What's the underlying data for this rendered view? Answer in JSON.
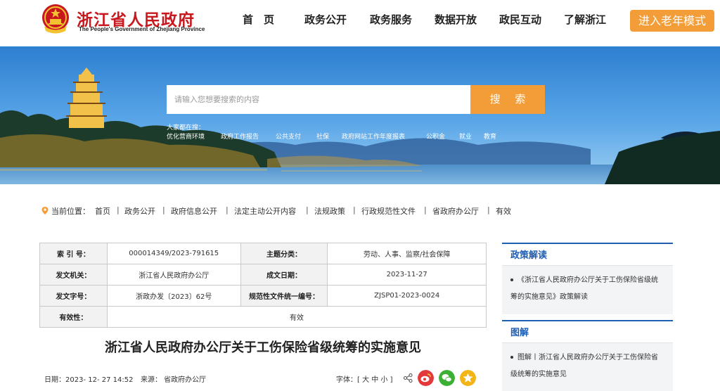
{
  "header": {
    "site_name_cn": "浙江省人民政府",
    "site_name_en": "The People's Government of Zhejiang Province",
    "nav": [
      "首　页",
      "政务公开",
      "政务服务",
      "数据开放",
      "政民互动",
      "了解浙江"
    ],
    "elder_mode": "进入老年模式"
  },
  "search": {
    "placeholder": "请输入您想要搜索的内容",
    "button": "搜 索",
    "hot_label": "大家都在搜：",
    "hot_links": [
      "优化营商环境",
      "政府工作报告",
      "公共支付",
      "社保",
      "政府网站工作年度报表",
      "公积金",
      "就业",
      "教育"
    ]
  },
  "breadcrumb": {
    "label": "当前位置：",
    "items": [
      "首页",
      "政务公开",
      "政府信息公开",
      "法定主动公开内容",
      "法规政策",
      "行政规范性文件",
      "省政府办公厅",
      "有效"
    ]
  },
  "info": {
    "index_label": "索 引 号：",
    "index_value": "000014349/2023-791615",
    "category_label": "主题分类：",
    "category_value": "劳动、人事、监察/社会保障",
    "issuer_label": "发文机关：",
    "issuer_value": "浙江省人民政府办公厅",
    "date_label": "成文日期：",
    "date_value": "2023-11-27",
    "docno_label": "发文字号：",
    "docno_value": "浙政办发〔2023〕62号",
    "code_label": "规范性文件统一编号：",
    "code_value": "ZJSP01-2023-0024",
    "validity_label": "有效性：",
    "validity_value": "有效"
  },
  "document": {
    "title": "浙江省人民政府办公厅关于工伤保险省级统筹的实施意见",
    "date_text": "日期：2023- 12- 27 14:52",
    "source_text": "来源：  省政府办公厅",
    "font_size_label": "字体：[ 大 中 小 ]"
  },
  "sidebar": {
    "policy_title": "政策解读",
    "policy_item": "《浙江省人民政府办公厅关于工伤保险省级统筹的实施意见》政策解读",
    "graphic_title": "图解",
    "graphic_item": "图解丨浙江省人民政府办公厅关于工伤保险省级统筹的实施意见"
  },
  "colors": {
    "brand_red": "#c8171d",
    "accent_orange": "#f29d38",
    "link_blue": "#1f5eb3"
  },
  "icons": [
    "national-emblem-icon",
    "location-pin-icon",
    "share-icon",
    "weibo-icon",
    "wechat-icon",
    "favorite-star-icon"
  ]
}
